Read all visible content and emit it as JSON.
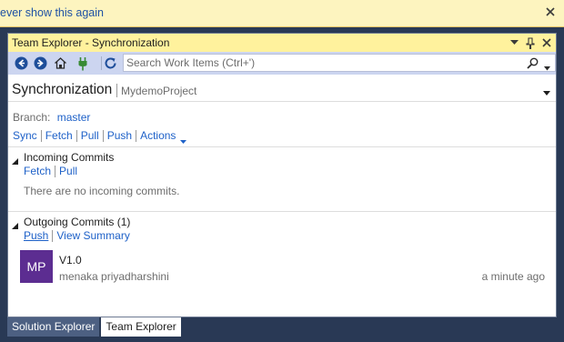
{
  "infobar": {
    "text": "ever show this again"
  },
  "window": {
    "title": "Team Explorer - Synchronization"
  },
  "toolbar": {
    "search_placeholder": "Search Work Items (Ctrl+')"
  },
  "page": {
    "title": "Synchronization",
    "project": "MydemoProject"
  },
  "branch": {
    "label": "Branch:",
    "value": "master"
  },
  "actions": [
    "Sync",
    "Fetch",
    "Pull",
    "Push",
    "Actions"
  ],
  "incoming": {
    "heading": "Incoming Commits",
    "links": [
      "Fetch",
      "Pull"
    ],
    "empty_text": "There are no incoming commits."
  },
  "outgoing": {
    "heading": "Outgoing Commits (1)",
    "links": [
      "Push",
      "View Summary"
    ],
    "commits": [
      {
        "initials": "MP",
        "message": "V1.0",
        "author": "menaka priyadharshini",
        "time": "a minute ago"
      }
    ]
  },
  "tabs": [
    "Solution Explorer",
    "Team Explorer"
  ],
  "colors": {
    "accent_link": "#1e61c8",
    "title_bar": "#fff29d",
    "toolbar": "#ccd5f0",
    "avatar": "#5c2d91",
    "background": "#293955"
  }
}
